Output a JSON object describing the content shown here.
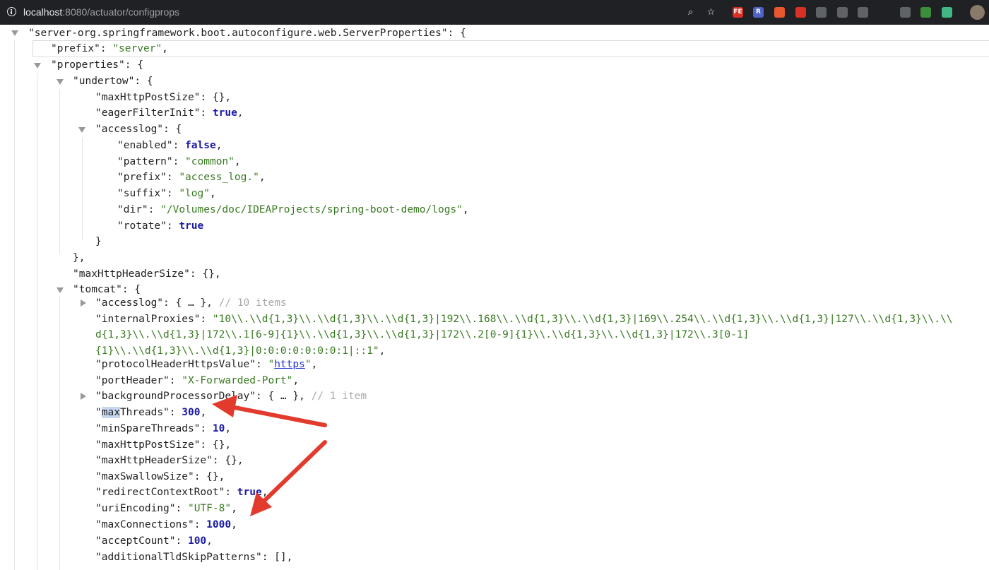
{
  "browser": {
    "url_host": "localhost",
    "url_rest": ":8080/actuator/configprops",
    "extensions": [
      {
        "icon": "fe-helper-icon",
        "label": "FE",
        "color": "#d93025"
      },
      {
        "icon": "extension-r-icon",
        "label": "R",
        "color": "#5063c8"
      },
      {
        "icon": "map-pin-icon",
        "label": "",
        "color": "#e8572e"
      },
      {
        "icon": "hand-stop-icon",
        "label": "",
        "color": "#d93025"
      },
      {
        "icon": "chat-bubble-icon",
        "label": "",
        "color": "#5f6368"
      },
      {
        "icon": "octocat-icon",
        "label": "",
        "color": "#5f6368"
      },
      {
        "icon": "shield-icon",
        "label": "",
        "color": "#5f6368"
      },
      {
        "icon": "dot-icon",
        "label": "",
        "color": "#202124"
      },
      {
        "icon": "gauge-icon",
        "label": "",
        "color": "#5f6368"
      },
      {
        "icon": "leaf-icon",
        "label": "",
        "color": "#3b8e3b"
      },
      {
        "icon": "vue-icon",
        "label": "",
        "color": "#41b883"
      }
    ]
  },
  "json": {
    "root_key": "\"server-org.springframework.boot.autoconfigure.web.ServerProperties\"",
    "prefix_key": "\"prefix\"",
    "prefix_value": "\"server\"",
    "properties_key": "\"properties\"",
    "undertow_key": "\"undertow\"",
    "undertow": {
      "maxHttpPostSize_key": "\"maxHttpPostSize\"",
      "maxHttpPostSize_value": "{}",
      "eagerFilterInit_key": "\"eagerFilterInit\"",
      "eagerFilterInit_value": "true",
      "accesslog_key": "\"accesslog\""
    },
    "accesslog": {
      "enabled_key": "\"enabled\"",
      "enabled_value": "false",
      "pattern_key": "\"pattern\"",
      "pattern_value": "\"common\"",
      "prefix_key": "\"prefix\"",
      "prefix_value": "\"access_log.\"",
      "suffix_key": "\"suffix\"",
      "suffix_value": "\"log\"",
      "dir_key": "\"dir\"",
      "dir_value": "\"/Volumes/doc/IDEAProjects/spring-boot-demo/logs\"",
      "rotate_key": "\"rotate\"",
      "rotate_value": "true"
    },
    "maxHttpHeaderSize_key": "\"maxHttpHeaderSize\"",
    "maxHttpHeaderSize_value": "{}",
    "tomcat_key": "\"tomcat\"",
    "tomcat": {
      "accesslog_key": "\"accesslog\"",
      "accesslog_collapsed": "{ … }",
      "accesslog_comment": "// 10 items",
      "internalProxies_key": "\"internalProxies\"",
      "internalProxies_line1": "\"10\\\\.\\\\d{1,3}\\\\.\\\\d{1,3}\\\\.\\\\d{1,3}|192\\\\.168\\\\.\\\\d{1,3}\\\\.\\\\d{1,3}|169\\\\.254\\\\.\\\\d{1,3}\\\\.\\\\d{1,3}|127\\\\.\\\\d{1,3}\\\\.\\\\",
      "internalProxies_line2": "d{1,3}\\\\.\\\\d{1,3}|172\\\\.1[6-9]{1}\\\\.\\\\d{1,3}\\\\.\\\\d{1,3}|172\\\\.2[0-9]{1}\\\\.\\\\d{1,3}\\\\.\\\\d{1,3}|172\\\\.3[0-1]",
      "internalProxies_line3": "{1}\\\\.\\\\d{1,3}\\\\.\\\\d{1,3}|0:0:0:0:0:0:0:1|::1\"",
      "protocolHeaderHttpsValue_key": "\"protocolHeaderHttpsValue\"",
      "protocolHeaderHttpsValue_value": "https",
      "portHeader_key": "\"portHeader\"",
      "portHeader_value": "\"X-Forwarded-Port\"",
      "backgroundProcessorDelay_key": "\"backgroundProcessorDelay\"",
      "backgroundProcessorDelay_collapsed": "{ … }",
      "backgroundProcessorDelay_comment": "// 1 item",
      "maxThreads_selected": "max",
      "maxThreads_rest": "Threads",
      "maxThreads_value": "300",
      "minSpareThreads_key": "\"minSpareThreads\"",
      "minSpareThreads_value": "10",
      "maxHttpPostSize_key": "\"maxHttpPostSize\"",
      "maxHttpPostSize_value": "{}",
      "maxHttpHeaderSize_key": "\"maxHttpHeaderSize\"",
      "maxHttpHeaderSize_value": "{}",
      "maxSwallowSize_key": "\"maxSwallowSize\"",
      "maxSwallowSize_value": "{}",
      "redirectContextRoot_key": "\"redirectContextRoot\"",
      "redirectContextRoot_value": "true",
      "uriEncoding_key": "\"uriEncoding\"",
      "uriEncoding_value": "\"UTF-8\"",
      "maxConnections_key": "\"maxConnections\"",
      "maxConnections_value": "1000",
      "acceptCount_key": "\"acceptCount\"",
      "acceptCount_value": "100",
      "additionalTldSkipPatterns_key": "\"additionalTldSkipPatterns\"",
      "additionalTldSkipPatterns_value": "[]"
    }
  },
  "annotations": {
    "arrow_color": "#e23b2e"
  }
}
